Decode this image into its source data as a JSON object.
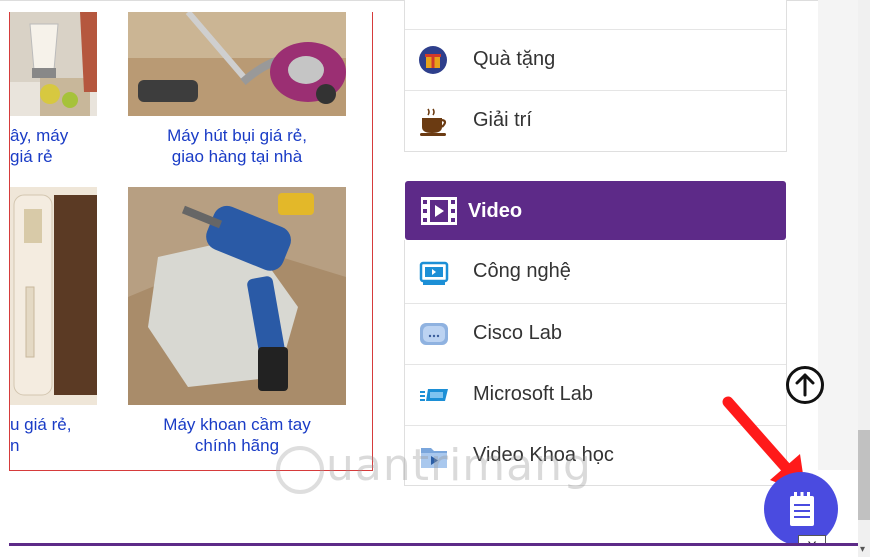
{
  "products": [
    {
      "caption_l1": "ây, máy",
      "caption_l2": "giá rẻ"
    },
    {
      "caption_l1": "Máy hút bụi giá rẻ,",
      "caption_l2": "giao hàng tại nhà"
    },
    {
      "caption_l1": "u giá rẻ,",
      "caption_l2": "n"
    },
    {
      "caption_l1": "Máy khoan cầm tay",
      "caption_l2": "chính hãng"
    }
  ],
  "menu_top": [
    {
      "label": "Quà tặng",
      "icon": "gift-icon"
    },
    {
      "label": "Giải trí",
      "icon": "coffee-icon"
    }
  ],
  "video": {
    "title": "Video",
    "items": [
      {
        "label": "Công nghệ",
        "icon": "monitor-icon"
      },
      {
        "label": "Cisco Lab",
        "icon": "cisco-icon"
      },
      {
        "label": "Microsoft Lab",
        "icon": "microsoft-icon"
      },
      {
        "label": "Video Khoa học",
        "icon": "video-folder-icon"
      }
    ]
  },
  "watermark": "uantrimang",
  "close_label": "X",
  "colors": {
    "accent": "#5d2a88",
    "link": "#1a3cc6",
    "border_red": "#d63b3b",
    "fab": "#4a4be0"
  }
}
